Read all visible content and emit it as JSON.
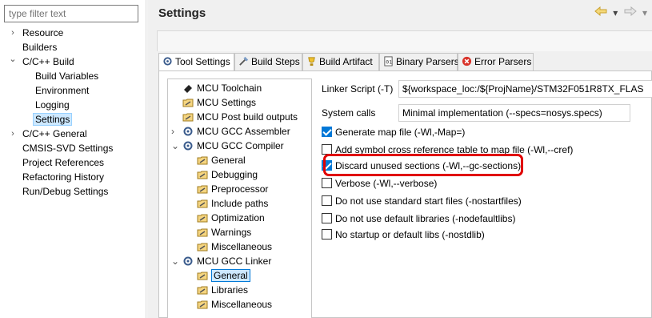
{
  "left_panel": {
    "filter_placeholder": "type filter text",
    "items": [
      {
        "label": "Resource",
        "chevron": "›"
      },
      {
        "label": "Builders",
        "chevron": ""
      },
      {
        "label": "C/C++ Build",
        "chevron": "⌄"
      },
      {
        "label": "Build Variables",
        "chevron": ""
      },
      {
        "label": "Environment",
        "chevron": ""
      },
      {
        "label": "Logging",
        "chevron": ""
      },
      {
        "label": "Settings",
        "chevron": ""
      },
      {
        "label": "C/C++ General",
        "chevron": "›"
      },
      {
        "label": "CMSIS-SVD Settings",
        "chevron": ""
      },
      {
        "label": "Project References",
        "chevron": ""
      },
      {
        "label": "Refactoring History",
        "chevron": ""
      },
      {
        "label": "Run/Debug Settings",
        "chevron": ""
      }
    ]
  },
  "header": {
    "title": "Settings"
  },
  "tabs": [
    {
      "label": "Tool Settings",
      "icon": "tool-settings-icon"
    },
    {
      "label": "Build Steps",
      "icon": "build-steps-icon"
    },
    {
      "label": "Build Artifact",
      "icon": "build-artifact-icon"
    },
    {
      "label": "Binary Parsers",
      "icon": "binary-parsers-icon"
    },
    {
      "label": "Error Parsers",
      "icon": "error-parsers-icon"
    }
  ],
  "tool_tree": [
    {
      "label": "MCU Toolchain",
      "icon": "toolchain-icon"
    },
    {
      "label": "MCU Settings",
      "icon": "settings-folder-icon"
    },
    {
      "label": "MCU Post build outputs",
      "icon": "settings-folder-icon"
    },
    {
      "label": "MCU GCC Assembler",
      "icon": "tool-gear-icon",
      "chevron": "›"
    },
    {
      "label": "MCU GCC Compiler",
      "icon": "tool-gear-icon",
      "chevron": "⌄"
    },
    {
      "label": "General",
      "icon": "settings-folder-icon"
    },
    {
      "label": "Debugging",
      "icon": "settings-folder-icon"
    },
    {
      "label": "Preprocessor",
      "icon": "settings-folder-icon"
    },
    {
      "label": "Include paths",
      "icon": "settings-folder-icon"
    },
    {
      "label": "Optimization",
      "icon": "settings-folder-icon"
    },
    {
      "label": "Warnings",
      "icon": "settings-folder-icon"
    },
    {
      "label": "Miscellaneous",
      "icon": "settings-folder-icon"
    },
    {
      "label": "MCU GCC Linker",
      "icon": "tool-gear-icon",
      "chevron": "⌄"
    },
    {
      "label": "General",
      "icon": "settings-folder-icon"
    },
    {
      "label": "Libraries",
      "icon": "settings-folder-icon"
    },
    {
      "label": "Miscellaneous",
      "icon": "settings-folder-icon"
    }
  ],
  "linker_settings": {
    "linker_script_label": "Linker Script (-T)",
    "linker_script_value": "${workspace_loc:/${ProjName}/STM32F051R8TX_FLAS",
    "system_calls_label": "System calls",
    "system_calls_value": "Minimal implementation (--specs=nosys.specs)",
    "options": [
      {
        "label": "Generate map file (-Wl,-Map=)",
        "checked": true
      },
      {
        "label": "Add symbol cross reference table to map file (-Wl,--cref)",
        "checked": false
      },
      {
        "label": "Discard unused sections (-Wl,--gc-sections)",
        "checked": true
      },
      {
        "label": "Verbose (-Wl,--verbose)",
        "checked": false
      },
      {
        "label": "Do not use standard start files (-nostartfiles)",
        "checked": false
      },
      {
        "label": "Do not use default libraries (-nodefaultlibs)",
        "checked": false
      },
      {
        "label": "No startup or default libs (-nostdlib)",
        "checked": false
      }
    ]
  },
  "colors": {
    "accent": "#0078d7",
    "highlight": "#e00000",
    "selection": "#cde8ff"
  }
}
